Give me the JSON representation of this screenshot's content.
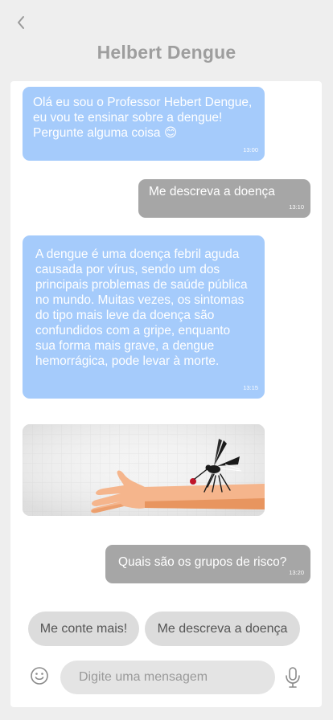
{
  "header": {
    "title": "Helbert Dengue"
  },
  "messages": [
    {
      "from": "bot",
      "text": "Olá eu sou o Professor Hebert Dengue, eu vou te ensinar sobre a dengue! Pergunte alguma coisa 😊",
      "time": "13:00"
    },
    {
      "from": "user",
      "text": "Me descreva a doença",
      "time": "13:10"
    },
    {
      "from": "bot",
      "text": "A dengue é uma doença febril aguda causada por vírus, sendo um dos principais problemas de saúde pública no mundo. Muitas vezes, os sintomas do tipo mais leve da doença são confundidos com a gripe, enquanto sua forma mais grave, a dengue hemorrágica, pode levar à morte.",
      "time": "13:15"
    },
    {
      "from": "bot",
      "type": "image",
      "image": "mosquito-on-arm-illustration"
    },
    {
      "from": "user",
      "text": "Quais são os grupos de risco?",
      "time": "13:20"
    }
  ],
  "suggestions": [
    "Me conte mais!",
    "Me descreva a doença"
  ],
  "composer": {
    "placeholder": "Digite uma mensagem",
    "emoji_icon": "smiley-icon",
    "mic_icon": "microphone-icon"
  },
  "colors": {
    "background": "#eeeeee",
    "bot_bubble": "#a5cbfb",
    "user_bubble": "#a6a6a6",
    "title": "#9e9e9e",
    "chip": "#dcdcdc"
  }
}
